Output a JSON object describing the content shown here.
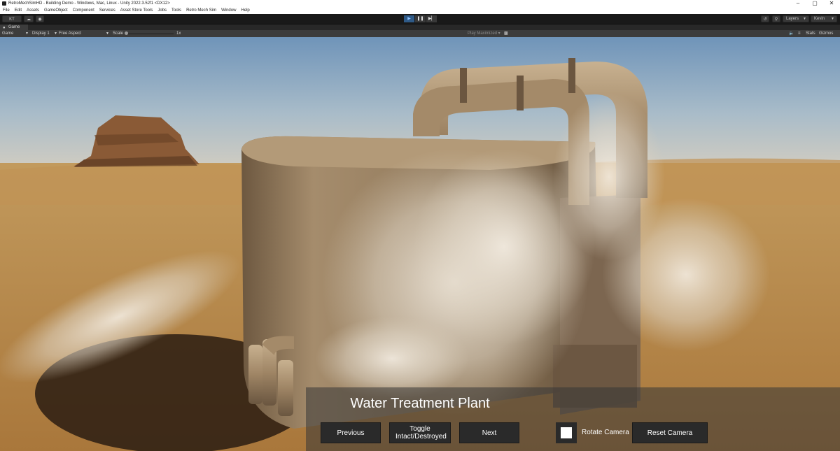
{
  "window": {
    "title": "RetroMechSimHD - Building Demo - Windows, Mac, Linux - Unity 2022.3.52f1 <DX12>",
    "controls": [
      "–",
      "▢",
      "✕"
    ]
  },
  "menu": [
    "File",
    "Edit",
    "Assets",
    "GameObject",
    "Component",
    "Services",
    "Asset Store Tools",
    "Jobs",
    "Tools",
    "Retro Mech Sim",
    "Window",
    "Help"
  ],
  "toolbar": {
    "account": "KT",
    "play_icon": "▶",
    "pause_icon": "❚❚",
    "step_icon": "▶▏",
    "layers_label": "Layers",
    "layout_label": "Kevin"
  },
  "game_tab": {
    "label": "Game"
  },
  "game_bar": {
    "view_select": "Game",
    "display_select": "Display 1",
    "aspect_select": "Free Aspect",
    "scale_label": "Scale",
    "scale_value": "1x",
    "play_mode_select": "Play Maximized",
    "stats_label": "Stats",
    "gizmos_label": "Gizmos"
  },
  "hud": {
    "building_name": "Water Treatment Plant",
    "previous_label": "Previous",
    "toggle_label": "Toggle Intact/Destroyed",
    "next_label": "Next",
    "rotate_camera_label": "Rotate Camera",
    "rotate_camera_checked": true,
    "reset_camera_label": "Reset Camera"
  },
  "colors": {
    "editor_bg": "#191919",
    "sky_top": "#6f94b9",
    "sand": "#b7894a",
    "play_active": "#2f5a87"
  }
}
